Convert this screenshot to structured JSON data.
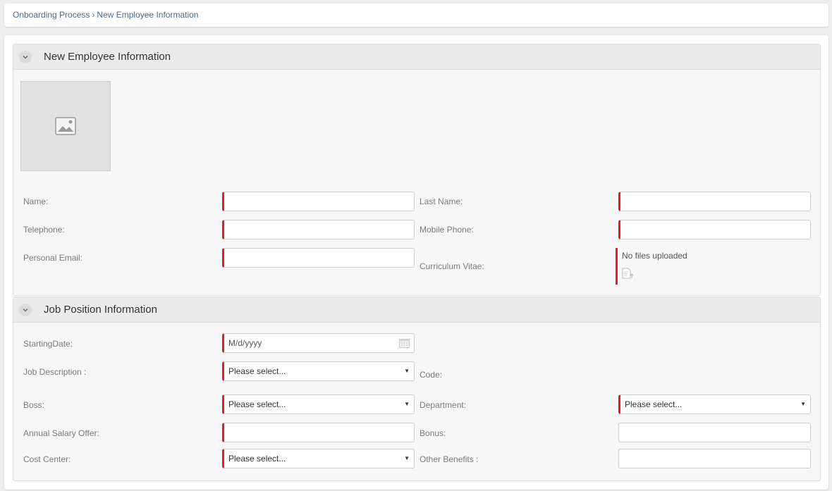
{
  "breadcrumb": {
    "parent": "Onboarding Process",
    "separator": "›",
    "current": "New Employee Information"
  },
  "employee_section": {
    "title": "New Employee Information",
    "photo_icon": "image-placeholder-icon",
    "fields": {
      "name_label": "Name:",
      "last_name_label": "Last Name:",
      "telephone_label": "Telephone:",
      "mobile_label": "Mobile Phone:",
      "email_label": "Personal Email:",
      "cv_label": "Curriculum Vitae:",
      "cv_status": "No files uploaded",
      "name_value": "",
      "last_name_value": "",
      "telephone_value": "",
      "mobile_value": "",
      "email_value": ""
    }
  },
  "job_section": {
    "title": "Job Position Information",
    "fields": {
      "starting_date_label": "StartingDate:",
      "starting_date_placeholder": "M/d/yyyy",
      "job_description_label": "Job Description :",
      "job_description_value": "Please select...",
      "code_label": "Code:",
      "boss_label": "Boss:",
      "boss_value": "Please select...",
      "department_label": "Department:",
      "department_value": "Please select...",
      "salary_label": "Annual Salary Offer:",
      "bonus_label": "Bonus:",
      "cost_center_label": "Cost Center:",
      "cost_center_value": "Please select...",
      "other_benefits_label": "Other Benefits :"
    }
  },
  "colors": {
    "required_marker": "#e02020",
    "link": "#4a6a86",
    "panel_header": "#ebebeb"
  }
}
